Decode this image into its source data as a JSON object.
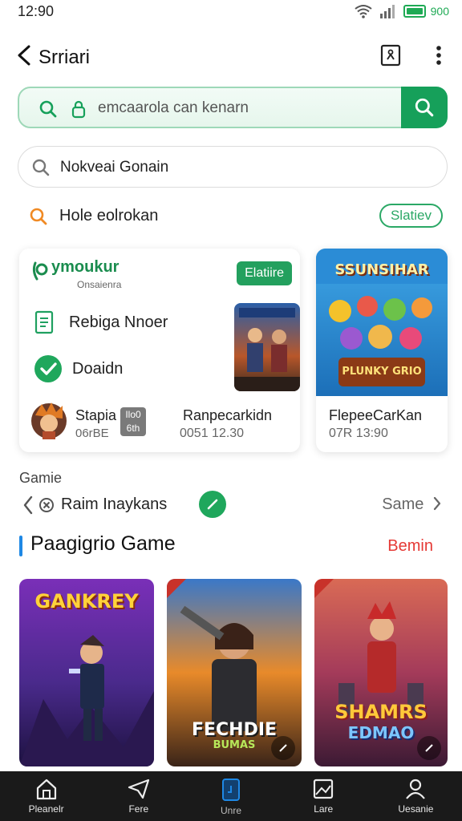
{
  "status_bar": {
    "time": "12:90",
    "battery": "900"
  },
  "header": {
    "title": "Srriari"
  },
  "search_primary": {
    "text": "emcaarola can kenarn"
  },
  "search_secondary": {
    "text": "Nokveai Gonain"
  },
  "recent": {
    "text": "Hole eolrokan",
    "pill": "Slatiev"
  },
  "featured_card": {
    "brand": "ymoukur",
    "subtitle": "Onsaienra",
    "button": "Elatiire",
    "rows": [
      {
        "label": "Rebiga Nnoer",
        "icon": "document-icon"
      },
      {
        "label": "Doaidn",
        "icon": "check-circle-icon"
      }
    ],
    "player_name": "Stapia",
    "player_meta": "06rBE",
    "badge": "Ilo0 6th",
    "item_name": "Ranpecarkidn",
    "item_meta": "0051 12.30"
  },
  "side_card": {
    "banner_title": "SSUNSIHAR",
    "banner_sub": "PLUNKY GRIO",
    "name": "FlepeeCarKan",
    "meta": "07R 13:90"
  },
  "section_label": "Gamie",
  "nav_row": {
    "text": "Raim Inaykans",
    "same": "Same"
  },
  "popular": {
    "title": "Paagigrio Game",
    "more": "Bemin"
  },
  "tiles": [
    {
      "title": "GANKREY",
      "subtitle": ""
    },
    {
      "title": "FECHDIE",
      "subtitle": "BUMAS"
    },
    {
      "title": "SHAMRS",
      "subtitle": "EDMAO"
    }
  ],
  "bottom_nav": [
    {
      "label": "Pleanelr",
      "icon": "home-icon"
    },
    {
      "label": "Fere",
      "icon": "send-icon"
    },
    {
      "label": "Unre",
      "icon": "card-icon"
    },
    {
      "label": "Lare",
      "icon": "image-icon"
    },
    {
      "label": "Uesanie",
      "icon": "user-icon"
    }
  ],
  "colors": {
    "accent": "#16a05a",
    "more_link": "#e53935",
    "section_bar": "#1e88e5",
    "nav_bg": "#1a1a1a"
  }
}
